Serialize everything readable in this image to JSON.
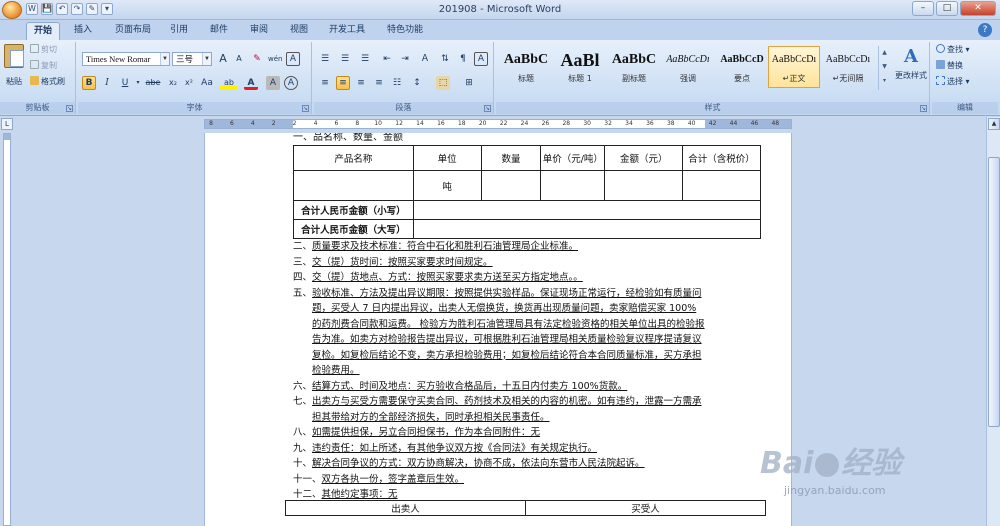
{
  "window": {
    "title": "201908 - Microsoft Word",
    "controls": {
      "minimize": "–",
      "restore": "□",
      "close": "✕"
    }
  },
  "quick_access": [
    "W",
    "💾",
    "↶",
    "↷",
    "✎",
    "▾"
  ],
  "tabs": [
    "开始",
    "插入",
    "页面布局",
    "引用",
    "邮件",
    "审阅",
    "视图",
    "开发工具",
    "特色功能"
  ],
  "active_tab": "开始",
  "help_glyph": "?",
  "clipboard": {
    "paste_label": "粘贴",
    "cut": "剪切",
    "copy": "复制",
    "format_painter": "格式刷",
    "group_label": "剪贴板"
  },
  "font": {
    "font_name": "Times New Romar",
    "font_size": "三号",
    "grow": "A",
    "shrink": "A",
    "clear": "✎",
    "phonetic": "wén",
    "border_char": "A",
    "bold": "B",
    "italic": "I",
    "underline": "U",
    "strike": "abe",
    "subscript": "x₂",
    "superscript": "x²",
    "change_case": "Aa",
    "highlight": "ab",
    "font_color": "A",
    "char_shading": "A",
    "enclose": "A",
    "group_label": "字体"
  },
  "paragraph": {
    "group_label": "段落",
    "row1": [
      "☰",
      "☰",
      "☰",
      "⇤",
      "⇥",
      "Ａ",
      "⇅",
      "¶",
      "A"
    ],
    "row2": [
      "≡",
      "≡",
      "≡",
      "≡",
      "☷",
      "↕",
      "⬚",
      "⊞"
    ]
  },
  "styles": {
    "group_label": "样式",
    "items": [
      {
        "sample": "AaBbC",
        "name": "标题"
      },
      {
        "sample": "AaBl",
        "name": "标题 1"
      },
      {
        "sample": "AaBbC",
        "name": "副标题"
      },
      {
        "sample": "AaBbCcDı",
        "name": "强调"
      },
      {
        "sample": "AaBbCcD",
        "name": "要点"
      },
      {
        "sample": "AaBbCcDı",
        "name": "↵正文"
      },
      {
        "sample": "AaBbCcDı",
        "name": "↵无间隔"
      }
    ],
    "selected_index": 5,
    "change_styles": "更改样式",
    "change_styles_icon": "A"
  },
  "editing": {
    "group_label": "编辑",
    "find": "查找",
    "replace": "替换",
    "select": "选择"
  },
  "ruler": {
    "ticks": [
      "8",
      "6",
      "4",
      "2",
      "2",
      "4",
      "6",
      "8",
      "10",
      "12",
      "14",
      "16",
      "18",
      "20",
      "22",
      "24",
      "26",
      "28",
      "30",
      "32",
      "34",
      "36",
      "38",
      "40",
      "42",
      "44",
      "46",
      "48"
    ]
  },
  "document": {
    "clipped_heading": "一、品名称、数量、金额",
    "product_table": {
      "headers": [
        "产品名称",
        "单位",
        "数量",
        "单价（元/吨）",
        "金额（元）",
        "合计（含税价）"
      ],
      "unit_value": "吨",
      "total_small": "合计人民币金额（小写）",
      "total_big": "合计人民币金额（大写）"
    },
    "clauses": [
      {
        "num": "二、",
        "text": "质量要求及技术标准：符合中石化和胜利石油管理局企业标准。"
      },
      {
        "num": "三、",
        "text": "交（提）货时间：按照买家要求时间规定。"
      },
      {
        "num": "四、",
        "text": "交（提）货地点、方式：按照买家要求卖方送至买方指定地点。。"
      },
      {
        "num": "五、",
        "text": "验收标准、方法及提出异议期限：按照提供实验样品。保证现场正常运行，经检验如有质量问题，买受人 7 日内提出异议，出卖人无偿换货，换货再出现质量问题，卖家赔偿买家 100%的药剂费合同款和运费。 检验方为胜利石油管理局具有法定检验资格的相关单位出具的检验报告为准。如卖方对检验报告提出异议，可根据胜利石油管理局相关质量检验复议程序提请复议复检。如复检后结论不变，卖方承担检验费用；如复检后结论符合本合同质量标准，买方承担检验费用。"
      },
      {
        "num": "六、",
        "text": "结算方式、时间及地点：买方验收合格品后，十五日内付卖方 100%货款。"
      },
      {
        "num": "七、",
        "text": "出卖方与买受方需要保守买卖合同、药剂技术及相关的内容的机密。如有违约，泄露一方需承担其带给对方的全部经济损失，同时承担相关民事责任。"
      },
      {
        "num": "八、",
        "text": "如需提供担保，另立合同担保书，作为本合同附件：无"
      },
      {
        "num": "九、",
        "text": "违约责任：如上所述，有其他争议双方按《合同法》有关规定执行。"
      },
      {
        "num": "十、",
        "text": "解决合同争议的方式：双方协商解决，协商不成，依法向东营市人民法院起诉。"
      },
      {
        "num": "十一、",
        "text": "   双方各执一份，签字盖章后生效。"
      },
      {
        "num": "十二、",
        "text": "   其他约定事项：无"
      }
    ],
    "signature": {
      "seller": "出卖人",
      "buyer": "买受人"
    }
  },
  "watermark": {
    "logo_left": "Bai",
    "logo_right": "经验",
    "url": "jingyan.baidu.com"
  }
}
